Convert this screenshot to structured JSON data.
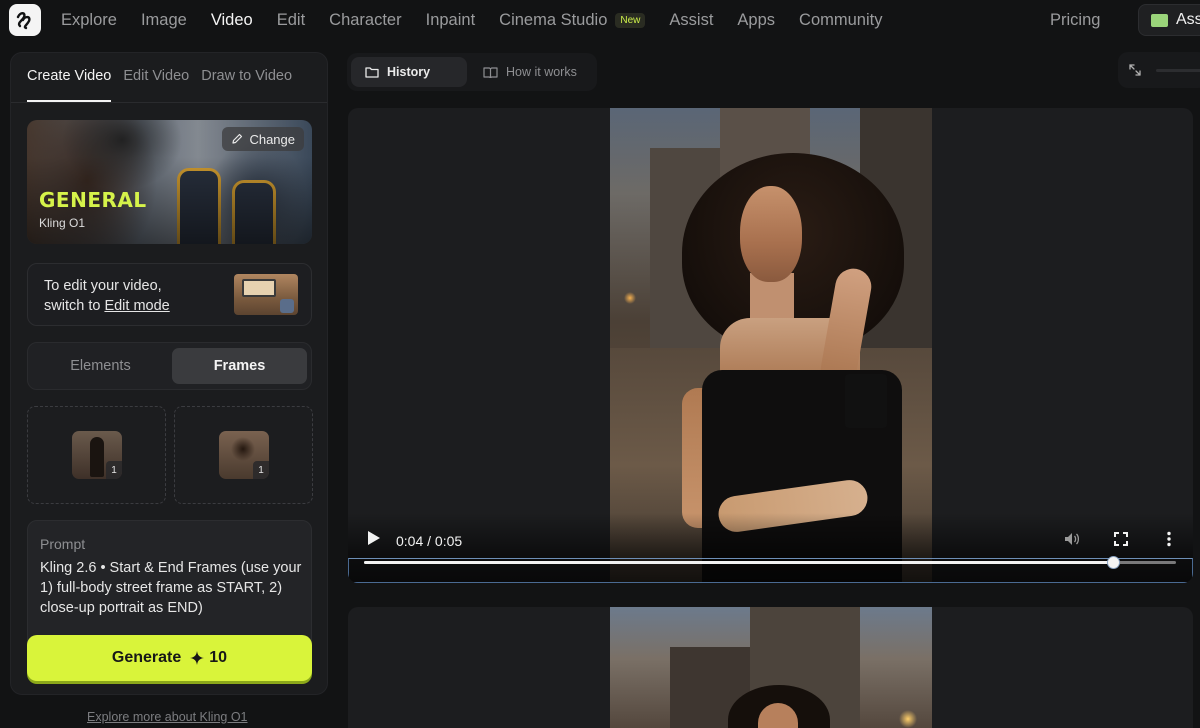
{
  "nav": {
    "items": [
      "Explore",
      "Image",
      "Video",
      "Edit",
      "Character",
      "Inpaint",
      "Cinema Studio",
      "Assist",
      "Apps",
      "Community"
    ],
    "active": "Video",
    "new_badge": "New",
    "pricing": "Pricing",
    "assets": "Ass"
  },
  "left": {
    "tabs": [
      "Create Video",
      "Edit Video",
      "Draw to Video"
    ],
    "model": {
      "name": "GENERAL",
      "sub": "Kling O1",
      "change": "Change"
    },
    "edit_hint": {
      "line1": "To edit your video,",
      "line2_prefix": "switch to ",
      "link": "Edit mode"
    },
    "segment": [
      "Elements",
      "Frames"
    ],
    "frames": [
      {
        "count": "1"
      },
      {
        "count": "1"
      }
    ],
    "prompt_label": "Prompt",
    "prompt_text": "Kling 2.6 • Start & End Frames (use your 1) full-body street frame as START, 2) close-up portrait as END)",
    "generate": "Generate",
    "credits": "10",
    "explore_more": "Explore more about Kling O1"
  },
  "right": {
    "tabs": [
      "History",
      "How it works"
    ],
    "video": {
      "time": "0:04 / 0:05",
      "progress": 0.922
    }
  },
  "colors": {
    "accent": "#d9f43a",
    "general_text": "#d6f34a"
  }
}
